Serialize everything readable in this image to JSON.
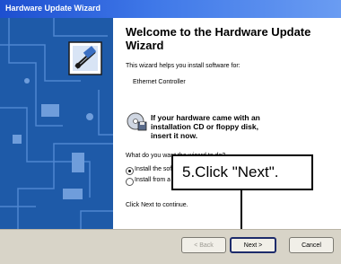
{
  "window": {
    "title": "Hardware Update Wizard"
  },
  "content": {
    "heading": "Welcome to the Hardware Update Wizard",
    "intro": "This wizard helps you install software for:",
    "device_name": "Ethernet Controller",
    "cd_notice": "If your hardware came with an installation CD or floppy disk, insert it now.",
    "question": "What do you want the wizard to do?",
    "option_1": "Install the software automatically (Recommended)",
    "option_2": "Install from a list or specific location (Advanced)",
    "continue_text": "Click Next to continue."
  },
  "callout": {
    "text": "5.Click \"Next\"."
  },
  "buttons": {
    "back": "< Back",
    "next": "Next >",
    "cancel": "Cancel"
  },
  "colors": {
    "title_bar": "#1d4fd0",
    "sidebar": "#1e5aa8",
    "callout_border": "#000000"
  },
  "icons": [
    "hardware-wizard-icon",
    "cd-floppy-icon",
    "arrow-down-icon"
  ]
}
